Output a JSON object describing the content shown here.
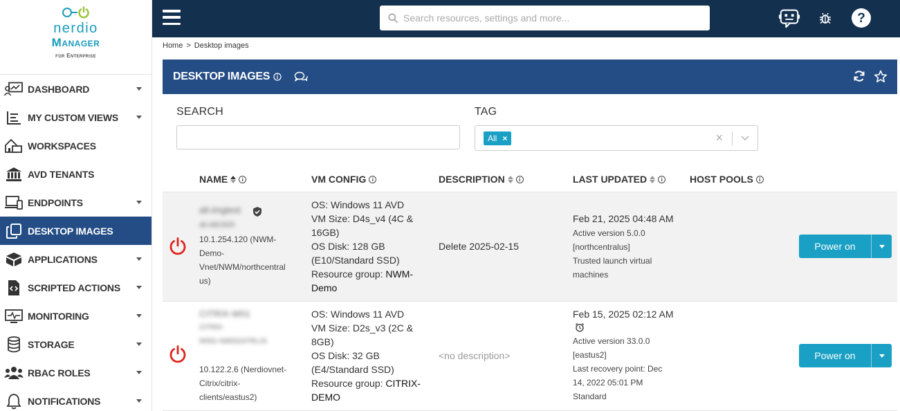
{
  "brand": {
    "name": "nerdio",
    "product": "Manager",
    "edition": "for Enterprise",
    "accent": "#1a9cbd"
  },
  "sidebar": {
    "items": [
      {
        "label": "DASHBOARD",
        "icon": "dashboard-icon",
        "has_caret": true
      },
      {
        "label": "MY CUSTOM VIEWS",
        "icon": "list-view-icon",
        "has_caret": true
      },
      {
        "label": "WORKSPACES",
        "icon": "workspace-icon",
        "has_caret": false
      },
      {
        "label": "AVD TENANTS",
        "icon": "bank-icon",
        "has_caret": false
      },
      {
        "label": "ENDPOINTS",
        "icon": "devices-icon",
        "has_caret": true
      },
      {
        "label": "DESKTOP IMAGES",
        "icon": "copy-icon",
        "has_caret": false,
        "active": true
      },
      {
        "label": "APPLICATIONS",
        "icon": "package-icon",
        "has_caret": true
      },
      {
        "label": "SCRIPTED ACTIONS",
        "icon": "script-file-icon",
        "has_caret": true
      },
      {
        "label": "MONITORING",
        "icon": "monitor-pulse-icon",
        "has_caret": true
      },
      {
        "label": "STORAGE",
        "icon": "database-icon",
        "has_caret": true
      },
      {
        "label": "RBAC ROLES",
        "icon": "users-icon",
        "has_caret": true
      },
      {
        "label": "NOTIFICATIONS",
        "icon": "bell-icon",
        "has_caret": true
      }
    ]
  },
  "topbar": {
    "search_placeholder": "Search resources, settings and more...",
    "bg": "#13304f"
  },
  "breadcrumb": {
    "home": "Home",
    "separator": ">",
    "current": "Desktop images"
  },
  "panel": {
    "title": "DESKTOP IMAGES",
    "bg": "#244d86"
  },
  "filters": {
    "search_label": "SEARCH",
    "search_value": "",
    "tag_label": "TAG",
    "tag_chip": "All",
    "tag_chip_remove": "×",
    "clear": "×"
  },
  "table": {
    "columns": {
      "name": "NAME",
      "vm_config": "VM CONFIG",
      "description": "DESCRIPTION",
      "last_updated": "LAST UPDATED",
      "host_pools": "HOST POOLS"
    },
    "rows": [
      {
        "name": "alt-imgtest",
        "sub": "alt-AB23D5",
        "network": "10.1.254.120 (NWM-Demo-Vnet/NWM/northcentralus)",
        "network_lines": [
          "10.1.254.120 (NWM-",
          "Demo-",
          "Vnet/NWM/northcentral",
          "us)"
        ],
        "os": "OS: Windows 11 AVD",
        "vm_size_lines": [
          "VM Size: D4s_v4 (4C &",
          "16GB)"
        ],
        "os_disk_lines": [
          "OS Disk: 128 GB",
          "(E10/Standard SSD)"
        ],
        "rg_label": "Resource group: ",
        "rg_value_lines": [
          "NWM-",
          "Demo"
        ],
        "description": "Delete 2025-02-15",
        "updated": "Feb 21, 2025 04:48 AM",
        "details": [
          "Active version 5.0.0",
          "[northcentralus]",
          "Trusted launch virtual",
          "machines"
        ],
        "action": "Power on"
      },
      {
        "name": "CITRIX-W01",
        "sub_lines": [
          "CITRIX-",
          "W001-NWDGSTRL15"
        ],
        "network_lines": [
          "10.122.2.6 (Nerdiovnet-",
          "Citrix/citrix-",
          "clients/eastus2)"
        ],
        "os": "OS: Windows 11 AVD",
        "vm_size_lines": [
          "VM Size: D2s_v3 (2C &",
          "8GB)"
        ],
        "os_disk_lines": [
          "OS Disk: 32 GB",
          "(E4/Standard SSD)"
        ],
        "rg_label": "Resource group: ",
        "rg_value_lines": [
          "CITRIX-",
          "DEMO"
        ],
        "description": "<no description>",
        "updated": "Feb 15, 2025 02:12 AM",
        "details": [
          "Active version 33.0.0",
          "[eastus2]",
          "Last recovery point: Dec",
          "14, 2022 05:01 PM",
          "Standard"
        ],
        "action": "Power on"
      }
    ]
  },
  "colors": {
    "power_icon": "#e0231c",
    "button": "#1aa0c4",
    "nav_active": "#244d86"
  }
}
